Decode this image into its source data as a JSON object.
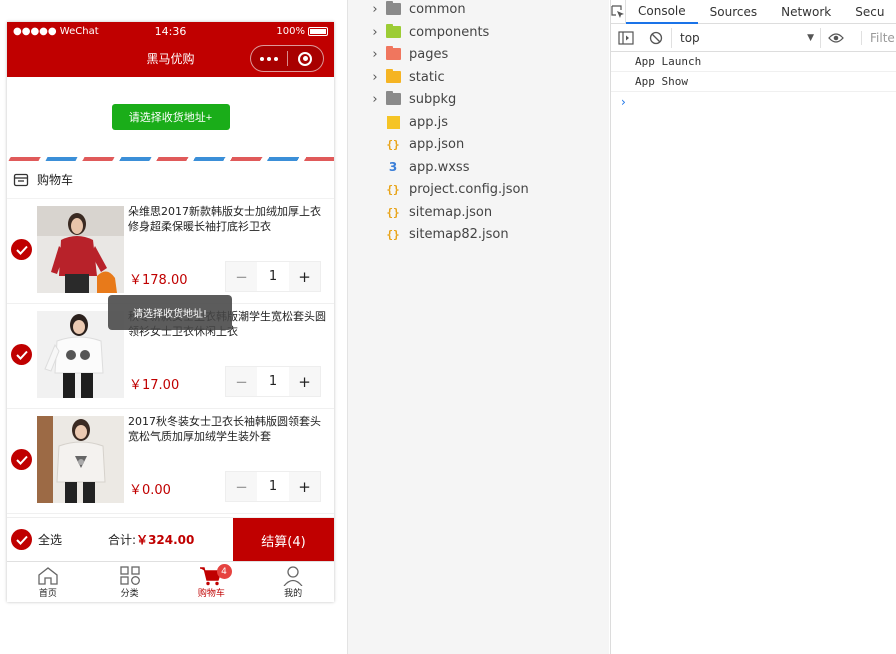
{
  "phone": {
    "status": {
      "carrier": "●●●●● WeChat",
      "time": "14:36",
      "battery": "100%"
    },
    "nav_title": "黑马优购",
    "address_button": "请选择收货地址+",
    "cart_title": "购物车",
    "goods": [
      {
        "name": "朵维思2017新款韩版女士加绒加厚上衣修身超柔保暖长袖打底衫卫衣",
        "price": "￥178.00",
        "qty": "1",
        "thumb": "red-sweater-photo"
      },
      {
        "name": "秋冬新款女士卫衣韩版潮学生宽松套头圆领衫女士卫衣休闲上衣",
        "price": "￥17.00",
        "qty": "1",
        "thumb": "white-sweatshirt-photo"
      },
      {
        "name": "2017秋冬装女士卫衣长袖韩版圆领套头宽松气质加厚加绒学生装外套",
        "price": "￥0.00",
        "qty": "1",
        "thumb": "white-pattern-sweater-photo"
      }
    ],
    "toast": "请选择收货地址!",
    "settle": {
      "select_all": "全选",
      "total_label": "合计:",
      "total_value": "￥324.00",
      "checkout": "结算(4)"
    },
    "tabbar": [
      {
        "label": "首页",
        "icon": "home-icon"
      },
      {
        "label": "分类",
        "icon": "category-icon"
      },
      {
        "label": "购物车",
        "icon": "cart-icon",
        "badge": "4"
      },
      {
        "label": "我的",
        "icon": "user-icon"
      }
    ],
    "colors": {
      "brand": "#c00000",
      "green": "#1aad19"
    }
  },
  "explorer": {
    "items": [
      {
        "label": "common",
        "kind": "folder",
        "color": "#8a8a8a"
      },
      {
        "label": "components",
        "kind": "folder",
        "color": "#9ccc35"
      },
      {
        "label": "pages",
        "kind": "folder",
        "color": "#f0765e"
      },
      {
        "label": "static",
        "kind": "folder",
        "color": "#f5b423"
      },
      {
        "label": "subpkg",
        "kind": "folder",
        "color": "#8a8a8a"
      },
      {
        "label": "app.js",
        "kind": "js"
      },
      {
        "label": "app.json",
        "kind": "json"
      },
      {
        "label": "app.wxss",
        "kind": "css"
      },
      {
        "label": "project.config.json",
        "kind": "json"
      },
      {
        "label": "sitemap.json",
        "kind": "json"
      },
      {
        "label": "sitemap82.json",
        "kind": "json"
      }
    ]
  },
  "devtools": {
    "tabs": [
      "Console",
      "Sources",
      "Network",
      "Secu"
    ],
    "active_tab": "Console",
    "context": "top",
    "filter_placeholder": "Filte",
    "logs": [
      "App  Launch",
      "App  Show"
    ],
    "prompt": "›"
  }
}
